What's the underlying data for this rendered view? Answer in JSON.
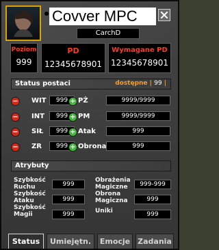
{
  "window": {
    "title": "Covver MPC",
    "close_label": "X",
    "character_name": "CarchD"
  },
  "level_panel": {
    "poziom_label": "Poziom",
    "poziom_value": "999",
    "pd_label": "PD",
    "pd_value": "12345678901",
    "wym_label": "Wymagane PD",
    "wym_value": "12345678901"
  },
  "status": {
    "header": "Status postaci",
    "available_label": "dostępne",
    "available_value": "99",
    "left_stats": [
      {
        "label": "WIT",
        "value": "999"
      },
      {
        "label": "INT",
        "value": "999"
      },
      {
        "label": "SIŁ",
        "value": "999"
      },
      {
        "label": "ZR",
        "value": "999"
      }
    ],
    "right_stats": [
      {
        "label": "PŻ",
        "value": "9999/9999"
      },
      {
        "label": "PM",
        "value": "9999/9999"
      },
      {
        "label": "Atak",
        "value": "999"
      },
      {
        "label": "Obrona",
        "value": "999"
      }
    ]
  },
  "attributes": {
    "header": "Atrybuty",
    "left": [
      {
        "label_line1": "Szybkość",
        "label_line2": "Ruchu",
        "value": "999"
      },
      {
        "label_line1": "Szybkość",
        "label_line2": "Ataku",
        "value": "999"
      },
      {
        "label_line1": "Szybkość",
        "label_line2": "Magii",
        "value": "999"
      }
    ],
    "right": [
      {
        "label_line1": "Obrażenia",
        "label_line2": "Magiczne",
        "value": "999-999"
      },
      {
        "label_line1": "Obrona",
        "label_line2": "Magiczna",
        "value": "999"
      },
      {
        "label_line1": "Uniki",
        "label_line2": "",
        "value": "999"
      }
    ]
  },
  "tabs": [
    {
      "label": "Status"
    },
    {
      "label": "Umiejętn."
    },
    {
      "label": "Emocje"
    },
    {
      "label": "Zadania"
    }
  ],
  "icons": {
    "portrait": "character-portrait-icon",
    "close": "close-icon",
    "minus": "minus-icon",
    "plus": "plus-icon"
  },
  "colors": {
    "accent_red": "#ff3b1f",
    "accent_orange": "#ff9a1a",
    "portrait_border": "#d9a400"
  }
}
